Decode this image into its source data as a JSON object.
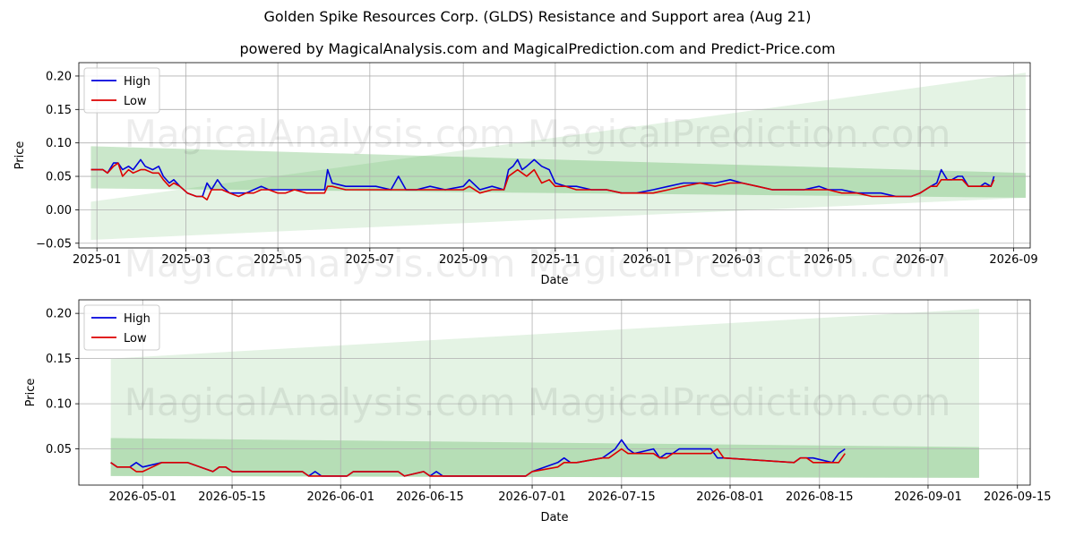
{
  "titles": {
    "title": "Golden Spike Resources Corp. (GLDS) Resistance and Support area (Aug 21)",
    "subtitle": "powered by MagicalAnalysis.com and MagicalPrediction.com and Predict-Price.com"
  },
  "watermark": "MagicalAnalysis.com    MagicalPrediction.com",
  "colors": {
    "high": "#0000dd",
    "low": "#dd0000",
    "band": "#2ca02c",
    "grid": "#b0b0b0"
  },
  "chart_data": [
    {
      "type": "line",
      "name": "full-history",
      "xlabel": "Date",
      "ylabel": "Price",
      "xlim": [
        "2024-12-20",
        "2026-09-12"
      ],
      "ylim": [
        -0.057,
        0.22
      ],
      "x_ticks": [
        "2025-01",
        "2025-03",
        "2025-05",
        "2025-07",
        "2025-09",
        "2025-11",
        "2026-01",
        "2026-03",
        "2026-05",
        "2026-07",
        "2026-09"
      ],
      "x_tick_dates": [
        "2025-01-01",
        "2025-03-01",
        "2025-05-01",
        "2025-07-01",
        "2025-09-01",
        "2025-11-01",
        "2026-01-01",
        "2026-03-01",
        "2026-05-01",
        "2026-07-01",
        "2026-09-01"
      ],
      "y_ticks": [
        -0.05,
        0.0,
        0.05,
        0.1,
        0.15,
        0.2
      ],
      "y_tick_labels": [
        "−0.05",
        "0.00",
        "0.05",
        "0.10",
        "0.15",
        "0.20"
      ],
      "legend": {
        "position": "top-left",
        "entries": [
          "High",
          "Low"
        ]
      },
      "grid": true,
      "bands": [
        {
          "x": [
            "2024-12-28",
            "2026-09-09"
          ],
          "top": [
            0.095,
            0.055
          ],
          "bottom": [
            0.032,
            0.018
          ],
          "shade": "dark"
        },
        {
          "x": [
            "2024-12-28",
            "2026-09-09"
          ],
          "top": [
            0.012,
            0.205
          ],
          "bottom": [
            -0.045,
            0.018
          ],
          "shade": "light"
        }
      ],
      "series": [
        {
          "name": "High",
          "x": [
            "2024-12-28",
            "2025-01-05",
            "2025-01-08",
            "2025-01-12",
            "2025-01-15",
            "2025-01-18",
            "2025-01-22",
            "2025-01-25",
            "2025-01-30",
            "2025-02-02",
            "2025-02-07",
            "2025-02-11",
            "2025-02-14",
            "2025-02-18",
            "2025-02-21",
            "2025-02-25",
            "2025-03-02",
            "2025-03-08",
            "2025-03-12",
            "2025-03-15",
            "2025-03-18",
            "2025-03-22",
            "2025-03-25",
            "2025-03-30",
            "2025-04-05",
            "2025-04-10",
            "2025-04-15",
            "2025-04-20",
            "2025-04-25",
            "2025-05-01",
            "2025-05-06",
            "2025-05-12",
            "2025-05-20",
            "2025-06-01",
            "2025-06-03",
            "2025-06-06",
            "2025-06-15",
            "2025-06-25",
            "2025-07-05",
            "2025-07-15",
            "2025-07-20",
            "2025-07-25",
            "2025-08-01",
            "2025-08-10",
            "2025-08-20",
            "2025-09-01",
            "2025-09-05",
            "2025-09-12",
            "2025-09-20",
            "2025-09-28",
            "2025-10-01",
            "2025-10-04",
            "2025-10-07",
            "2025-10-10",
            "2025-10-13",
            "2025-10-18",
            "2025-10-23",
            "2025-10-28",
            "2025-11-01",
            "2025-11-08",
            "2025-11-15",
            "2025-11-25",
            "2025-12-05",
            "2025-12-15",
            "2025-12-25",
            "2026-01-05",
            "2026-01-15",
            "2026-01-25",
            "2026-02-05",
            "2026-02-15",
            "2026-02-25",
            "2026-03-05",
            "2026-03-15",
            "2026-03-25",
            "2026-04-05",
            "2026-04-15",
            "2026-04-25",
            "2026-05-01",
            "2026-05-10",
            "2026-05-20",
            "2026-05-30",
            "2026-06-05",
            "2026-06-15",
            "2026-06-25",
            "2026-07-01",
            "2026-07-08",
            "2026-07-12",
            "2026-07-15",
            "2026-07-19",
            "2026-07-22",
            "2026-07-26",
            "2026-07-29",
            "2026-08-02",
            "2026-08-10",
            "2026-08-13",
            "2026-08-17",
            "2026-08-19"
          ],
          "y": [
            0.06,
            0.06,
            0.055,
            0.07,
            0.07,
            0.06,
            0.065,
            0.06,
            0.075,
            0.065,
            0.06,
            0.065,
            0.05,
            0.04,
            0.045,
            0.035,
            0.025,
            0.02,
            0.02,
            0.04,
            0.03,
            0.045,
            0.035,
            0.025,
            0.025,
            0.025,
            0.03,
            0.035,
            0.03,
            0.03,
            0.03,
            0.03,
            0.03,
            0.03,
            0.06,
            0.04,
            0.035,
            0.035,
            0.035,
            0.03,
            0.05,
            0.03,
            0.03,
            0.035,
            0.03,
            0.035,
            0.045,
            0.03,
            0.035,
            0.03,
            0.06,
            0.065,
            0.075,
            0.06,
            0.065,
            0.075,
            0.065,
            0.06,
            0.04,
            0.035,
            0.035,
            0.03,
            0.03,
            0.025,
            0.025,
            0.03,
            0.035,
            0.04,
            0.04,
            0.04,
            0.045,
            0.04,
            0.035,
            0.03,
            0.03,
            0.03,
            0.035,
            0.03,
            0.03,
            0.025,
            0.025,
            0.025,
            0.02,
            0.02,
            0.025,
            0.035,
            0.04,
            0.06,
            0.045,
            0.045,
            0.05,
            0.05,
            0.035,
            0.035,
            0.04,
            0.035,
            0.05
          ]
        },
        {
          "name": "Low",
          "x": [
            "2024-12-28",
            "2025-01-05",
            "2025-01-08",
            "2025-01-12",
            "2025-01-15",
            "2025-01-18",
            "2025-01-22",
            "2025-01-25",
            "2025-01-30",
            "2025-02-02",
            "2025-02-07",
            "2025-02-11",
            "2025-02-14",
            "2025-02-18",
            "2025-02-21",
            "2025-02-25",
            "2025-03-02",
            "2025-03-08",
            "2025-03-12",
            "2025-03-15",
            "2025-03-18",
            "2025-03-22",
            "2025-03-25",
            "2025-03-30",
            "2025-04-05",
            "2025-04-10",
            "2025-04-15",
            "2025-04-20",
            "2025-04-25",
            "2025-05-01",
            "2025-05-06",
            "2025-05-12",
            "2025-05-20",
            "2025-06-01",
            "2025-06-03",
            "2025-06-06",
            "2025-06-15",
            "2025-06-25",
            "2025-07-05",
            "2025-07-15",
            "2025-07-20",
            "2025-07-25",
            "2025-08-01",
            "2025-08-10",
            "2025-08-20",
            "2025-09-01",
            "2025-09-05",
            "2025-09-12",
            "2025-09-20",
            "2025-09-28",
            "2025-10-01",
            "2025-10-04",
            "2025-10-07",
            "2025-10-10",
            "2025-10-13",
            "2025-10-18",
            "2025-10-23",
            "2025-10-28",
            "2025-11-01",
            "2025-11-08",
            "2025-11-15",
            "2025-11-25",
            "2025-12-05",
            "2025-12-15",
            "2025-12-25",
            "2026-01-05",
            "2026-01-15",
            "2026-01-25",
            "2026-02-05",
            "2026-02-15",
            "2026-02-25",
            "2026-03-05",
            "2026-03-15",
            "2026-03-25",
            "2026-04-05",
            "2026-04-15",
            "2026-04-25",
            "2026-05-01",
            "2026-05-10",
            "2026-05-20",
            "2026-05-30",
            "2026-06-05",
            "2026-06-15",
            "2026-06-25",
            "2026-07-01",
            "2026-07-08",
            "2026-07-12",
            "2026-07-15",
            "2026-07-19",
            "2026-07-22",
            "2026-07-26",
            "2026-07-29",
            "2026-08-02",
            "2026-08-10",
            "2026-08-13",
            "2026-08-17",
            "2026-08-19"
          ],
          "y": [
            0.06,
            0.06,
            0.055,
            0.065,
            0.07,
            0.05,
            0.06,
            0.055,
            0.06,
            0.06,
            0.055,
            0.055,
            0.045,
            0.035,
            0.04,
            0.035,
            0.025,
            0.02,
            0.02,
            0.015,
            0.03,
            0.03,
            0.03,
            0.025,
            0.02,
            0.025,
            0.025,
            0.03,
            0.03,
            0.025,
            0.025,
            0.03,
            0.025,
            0.025,
            0.035,
            0.035,
            0.03,
            0.03,
            0.03,
            0.03,
            0.03,
            0.03,
            0.03,
            0.03,
            0.03,
            0.03,
            0.035,
            0.025,
            0.03,
            0.03,
            0.05,
            0.055,
            0.06,
            0.055,
            0.05,
            0.06,
            0.04,
            0.045,
            0.035,
            0.035,
            0.03,
            0.03,
            0.03,
            0.025,
            0.025,
            0.025,
            0.03,
            0.035,
            0.04,
            0.035,
            0.04,
            0.04,
            0.035,
            0.03,
            0.03,
            0.03,
            0.03,
            0.03,
            0.025,
            0.025,
            0.02,
            0.02,
            0.02,
            0.02,
            0.025,
            0.035,
            0.035,
            0.045,
            0.045,
            0.045,
            0.045,
            0.045,
            0.035,
            0.035,
            0.035,
            0.035,
            0.045
          ]
        }
      ]
    },
    {
      "type": "line",
      "name": "recent-zoom",
      "xlabel": "Date",
      "ylabel": "Price",
      "xlim": [
        "2026-04-21",
        "2026-09-17"
      ],
      "ylim": [
        0.01,
        0.215
      ],
      "x_ticks": [
        "2026-05-01",
        "2026-05-15",
        "2026-06-01",
        "2026-06-15",
        "2026-07-01",
        "2026-07-15",
        "2026-08-01",
        "2026-08-15",
        "2026-09-01",
        "2026-09-15"
      ],
      "y_ticks": [
        0.05,
        0.1,
        0.15,
        0.2
      ],
      "y_tick_labels": [
        "0.05",
        "0.10",
        "0.15",
        "0.20"
      ],
      "legend": {
        "position": "top-left",
        "entries": [
          "High",
          "Low"
        ]
      },
      "grid": true,
      "bands": [
        {
          "x": [
            "2026-04-26",
            "2026-09-09"
          ],
          "top": [
            0.062,
            0.052
          ],
          "bottom": [
            0.02,
            0.018
          ],
          "shade": "dark"
        },
        {
          "x": [
            "2026-04-26",
            "2026-09-09"
          ],
          "top": [
            0.15,
            0.205
          ],
          "bottom": [
            0.02,
            0.018
          ],
          "shade": "light"
        }
      ],
      "series": [
        {
          "name": "High",
          "x": [
            "2026-04-26",
            "2026-04-27",
            "2026-04-29",
            "2026-04-30",
            "2026-05-01",
            "2026-05-04",
            "2026-05-08",
            "2026-05-12",
            "2026-05-13",
            "2026-05-14",
            "2026-05-15",
            "2026-05-26",
            "2026-05-27",
            "2026-05-28",
            "2026-05-29",
            "2026-06-01",
            "2026-06-02",
            "2026-06-03",
            "2026-06-10",
            "2026-06-11",
            "2026-06-14",
            "2026-06-15",
            "2026-06-16",
            "2026-06-17",
            "2026-06-30",
            "2026-07-01",
            "2026-07-05",
            "2026-07-06",
            "2026-07-07",
            "2026-07-08",
            "2026-07-12",
            "2026-07-13",
            "2026-07-14",
            "2026-07-15",
            "2026-07-16",
            "2026-07-17",
            "2026-07-20",
            "2026-07-21",
            "2026-07-22",
            "2026-07-23",
            "2026-07-24",
            "2026-07-28",
            "2026-07-29",
            "2026-07-30",
            "2026-07-31",
            "2026-08-11",
            "2026-08-12",
            "2026-08-13",
            "2026-08-14",
            "2026-08-17",
            "2026-08-18",
            "2026-08-19"
          ],
          "y": [
            0.035,
            0.03,
            0.03,
            0.035,
            0.03,
            0.035,
            0.035,
            0.025,
            0.03,
            0.03,
            0.025,
            0.025,
            0.02,
            0.025,
            0.02,
            0.02,
            0.02,
            0.025,
            0.025,
            0.02,
            0.025,
            0.02,
            0.025,
            0.02,
            0.02,
            0.025,
            0.035,
            0.04,
            0.035,
            0.035,
            0.04,
            0.045,
            0.05,
            0.06,
            0.05,
            0.045,
            0.05,
            0.04,
            0.045,
            0.045,
            0.05,
            0.05,
            0.05,
            0.04,
            0.04,
            0.035,
            0.04,
            0.04,
            0.04,
            0.035,
            0.045,
            0.05
          ]
        },
        {
          "name": "Low",
          "x": [
            "2026-04-26",
            "2026-04-27",
            "2026-04-29",
            "2026-04-30",
            "2026-05-01",
            "2026-05-04",
            "2026-05-08",
            "2026-05-12",
            "2026-05-13",
            "2026-05-14",
            "2026-05-15",
            "2026-05-26",
            "2026-05-27",
            "2026-05-28",
            "2026-05-29",
            "2026-06-01",
            "2026-06-02",
            "2026-06-03",
            "2026-06-10",
            "2026-06-11",
            "2026-06-14",
            "2026-06-15",
            "2026-06-16",
            "2026-06-17",
            "2026-06-30",
            "2026-07-01",
            "2026-07-05",
            "2026-07-06",
            "2026-07-07",
            "2026-07-08",
            "2026-07-12",
            "2026-07-13",
            "2026-07-14",
            "2026-07-15",
            "2026-07-16",
            "2026-07-17",
            "2026-07-20",
            "2026-07-21",
            "2026-07-22",
            "2026-07-23",
            "2026-07-24",
            "2026-07-28",
            "2026-07-29",
            "2026-07-30",
            "2026-07-31",
            "2026-08-11",
            "2026-08-12",
            "2026-08-13",
            "2026-08-14",
            "2026-08-17",
            "2026-08-18",
            "2026-08-19"
          ],
          "y": [
            0.035,
            0.03,
            0.03,
            0.025,
            0.025,
            0.035,
            0.035,
            0.025,
            0.03,
            0.03,
            0.025,
            0.025,
            0.02,
            0.02,
            0.02,
            0.02,
            0.02,
            0.025,
            0.025,
            0.02,
            0.025,
            0.02,
            0.02,
            0.02,
            0.02,
            0.025,
            0.03,
            0.035,
            0.035,
            0.035,
            0.04,
            0.04,
            0.045,
            0.05,
            0.045,
            0.045,
            0.045,
            0.04,
            0.04,
            0.045,
            0.045,
            0.045,
            0.045,
            0.05,
            0.04,
            0.035,
            0.04,
            0.04,
            0.035,
            0.035,
            0.035,
            0.045
          ]
        }
      ]
    }
  ]
}
